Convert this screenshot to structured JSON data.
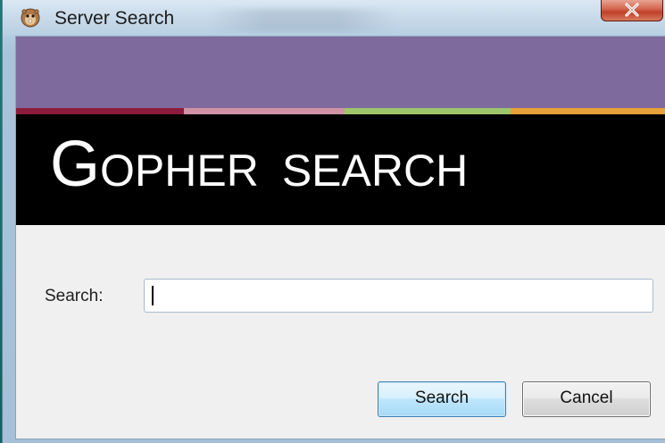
{
  "window": {
    "title": "Server Search",
    "close_glyph": "x",
    "icon": "gopher-icon"
  },
  "banner": {
    "logo_initial": "G",
    "logo_rest": "OPHER",
    "logo_suffix": "SEARCH",
    "colors": {
      "top": "#7f6a9e",
      "stripes": [
        "#8e1a3c",
        "#cf93a5",
        "#9ec66b",
        "#e6a13b"
      ],
      "background": "#000000"
    }
  },
  "form": {
    "search_label": "Search:",
    "search_value": "",
    "search_placeholder": ""
  },
  "buttons": {
    "search_label": "Search",
    "cancel_label": "Cancel"
  }
}
